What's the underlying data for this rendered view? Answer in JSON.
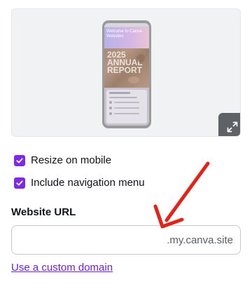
{
  "preview": {
    "phone_hero_text": "Welcome to Canva Websites",
    "phone_photo_text": "2025 ANNUAL REPORT",
    "expand_icon": "expand-icon"
  },
  "options": [
    {
      "label": "Resize on mobile",
      "checked": true
    },
    {
      "label": "Include navigation menu",
      "checked": true
    }
  ],
  "website_url": {
    "label": "Website URL",
    "value": "",
    "suffix": ".my.canva.site"
  },
  "custom_domain_link": "Use a custom domain",
  "colors": {
    "accent": "#7d2ae8",
    "link": "#6b22d3",
    "annotation": "#e2231a"
  }
}
